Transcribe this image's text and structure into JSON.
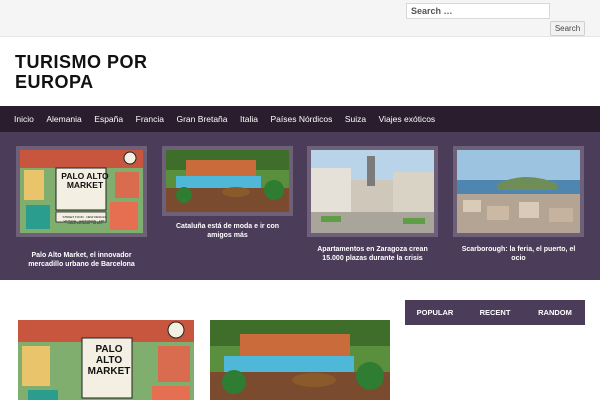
{
  "search": {
    "placeholder": "Search …",
    "button_label": "Search"
  },
  "site": {
    "title": "TURISMO POR EUROPA"
  },
  "nav": {
    "items": [
      "Inicio",
      "Alemania",
      "España",
      "Francia",
      "Gran Bretaña",
      "Italia",
      "Países Nórdicos",
      "Suiza",
      "Viajes exóticos"
    ]
  },
  "featured": [
    {
      "caption": "Palo Alto Market, el innovador mercadillo urbano de Barcelona",
      "image": "palo-alto-market-illustration",
      "sign_text": "PALO ALTO MARKET",
      "sign_sub": "STREET FOOD · NEW DESIGN · VINTAGE · HANDMADE · ART · OPEN STUDIOS · MUSIC"
    },
    {
      "caption": "Cataluña está de moda e ir con amigos más",
      "image": "pool-garden-photo"
    },
    {
      "caption": "Apartamentos en Zaragoza crean 15.000 plazas durante la crisis",
      "image": "city-square-photo"
    },
    {
      "caption": "Scarborough: la feria, el puerto, el ocio",
      "image": "coastal-town-photo"
    }
  ],
  "tabs": [
    "POPULAR",
    "RECENT",
    "RANDOM"
  ],
  "posts": [
    {
      "image": "palo-alto-market-illustration",
      "sign_text": "PALO ALTO MARKET"
    },
    {
      "image": "pool-garden-photo"
    }
  ],
  "colors": {
    "nav_bg": "#2a1d2e",
    "featured_bg": "#4b3c5a",
    "tab_bg": "#4b3c5a"
  }
}
